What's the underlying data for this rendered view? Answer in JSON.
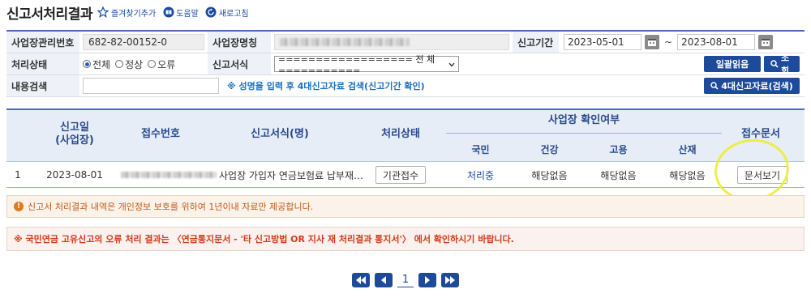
{
  "header": {
    "title": "신고서처리결과",
    "links": [
      {
        "label": "즐겨찾기추가",
        "icon": "star-icon"
      },
      {
        "label": "도움말",
        "icon": "book-icon"
      },
      {
        "label": "새로고침",
        "icon": "refresh-icon"
      }
    ]
  },
  "form": {
    "biz_no_label": "사업장관리번호",
    "biz_no_value": "682-82-00152-0",
    "biz_name_label": "사업장명칭",
    "period_label": "신고기간",
    "date_from": "2023-05-01",
    "date_sep": "~",
    "date_to": "2023-08-01",
    "status_label": "처리상태",
    "status_options": [
      "전체",
      "정상",
      "오류"
    ],
    "status_selected": "전체",
    "form_label": "신고서식",
    "form_select_value": "================== 전 체 ===========",
    "content_label": "내용검색",
    "content_value": "",
    "hint": "※ 성명을 입력 후 4대신고자료 검색(신고기간 확인)",
    "bulk_read_button": "일괄읽음",
    "search_button": "조회",
    "search4_button": "4대신고자료(검색)"
  },
  "table": {
    "headers": {
      "date": "신고일\n(사업장)",
      "receipt_no": "접수번호",
      "form_name": "신고서식(명)",
      "status": "처리상태",
      "confirm_group": "사업장 확인여부",
      "pension": "국민",
      "health": "건강",
      "employment": "고용",
      "industrial": "산재",
      "doc": "접수문서"
    },
    "rows": [
      {
        "no": "1",
        "date": "2023-08-01",
        "form_name": "사업장 가입자 연금보험료 납부재…",
        "status": "기관접수",
        "pension": "처리중",
        "health": "해당없음",
        "employment": "해당없음",
        "industrial": "해당없음",
        "doc_button": "문서보기"
      }
    ]
  },
  "notices": {
    "privacy": "신고서 처리결과 내역은 개인정보 보호를 위하여 1년이내 자료만 제공합니다.",
    "pension_error": "※ 국민연금 고유신고의 오류 처리 결과는 〈연금통지문서 - '타 신고방법 OR 지사 재 처리결과 통지서'〉 에서 확인하시기 바랍니다."
  },
  "pagination": {
    "current_page": "1"
  },
  "colors": {
    "navy": "#1e4a9a",
    "header_bg": "#e7edf7",
    "pension_status": "#1a4aa0",
    "highlight": "#ecec2a"
  }
}
